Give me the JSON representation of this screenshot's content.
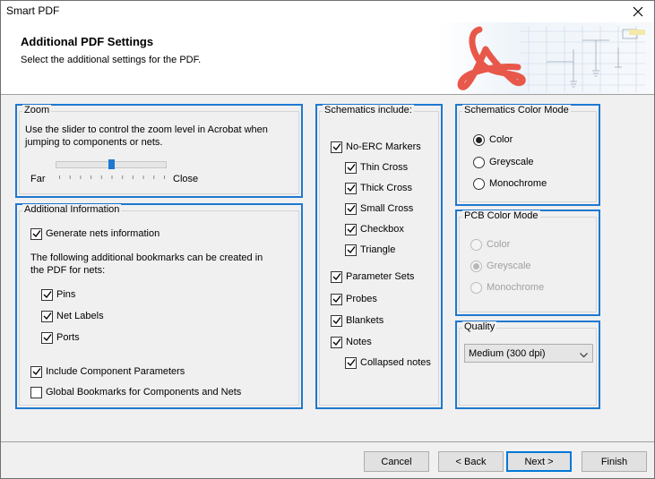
{
  "window": {
    "title": "Smart PDF"
  },
  "header": {
    "title": "Additional PDF Settings",
    "subtitle": "Select the additional settings for the PDF."
  },
  "zoom": {
    "label": "Zoom",
    "description_line1": "Use the slider to control the zoom level in Acrobat when",
    "description_line2": "jumping to components or nets.",
    "far_label": "Far",
    "close_label": "Close",
    "level": 0.5
  },
  "additional_info": {
    "label": "Additional Information",
    "generate_nets": {
      "label": "Generate nets information",
      "checked": true
    },
    "bookmarks_text_line1": "The following additional bookmarks can be created in",
    "bookmarks_text_line2": "the PDF for nets:",
    "pins": {
      "label": "Pins",
      "checked": true
    },
    "net_labels": {
      "label": "Net Labels",
      "checked": true
    },
    "ports": {
      "label": "Ports",
      "checked": true
    },
    "include_params": {
      "label": "Include Component Parameters",
      "checked": true
    },
    "global_bookmarks": {
      "label": "Global Bookmarks for Components and Nets",
      "checked": false
    }
  },
  "schematics": {
    "label": "Schematics include:",
    "no_erc": {
      "label": "No-ERC Markers",
      "checked": true
    },
    "thin_cross": {
      "label": "Thin Cross",
      "checked": true
    },
    "thick_cross": {
      "label": "Thick Cross",
      "checked": true
    },
    "small_cross": {
      "label": "Small Cross",
      "checked": true
    },
    "checkbox": {
      "label": "Checkbox",
      "checked": true
    },
    "triangle": {
      "label": "Triangle",
      "checked": true
    },
    "parameter_sets": {
      "label": "Parameter Sets",
      "checked": true
    },
    "probes": {
      "label": "Probes",
      "checked": true
    },
    "blankets": {
      "label": "Blankets",
      "checked": true
    },
    "notes": {
      "label": "Notes",
      "checked": true
    },
    "collapsed_notes": {
      "label": "Collapsed notes",
      "checked": true
    }
  },
  "sch_color": {
    "label": "Schematics Color Mode",
    "options": [
      "Color",
      "Greyscale",
      "Monochrome"
    ],
    "selected": "Color"
  },
  "pcb_color": {
    "label": "PCB Color Mode",
    "options": [
      "Color",
      "Greyscale",
      "Monochrome"
    ],
    "selected": "Greyscale",
    "disabled": true
  },
  "quality": {
    "label": "Quality",
    "value": "Medium (300 dpi)"
  },
  "buttons": {
    "cancel": "Cancel",
    "back": "< Back",
    "next": "Next >",
    "finish": "Finish"
  },
  "colors": {
    "accent": "#1e78d0",
    "acrobat_red": "#e8584a"
  }
}
